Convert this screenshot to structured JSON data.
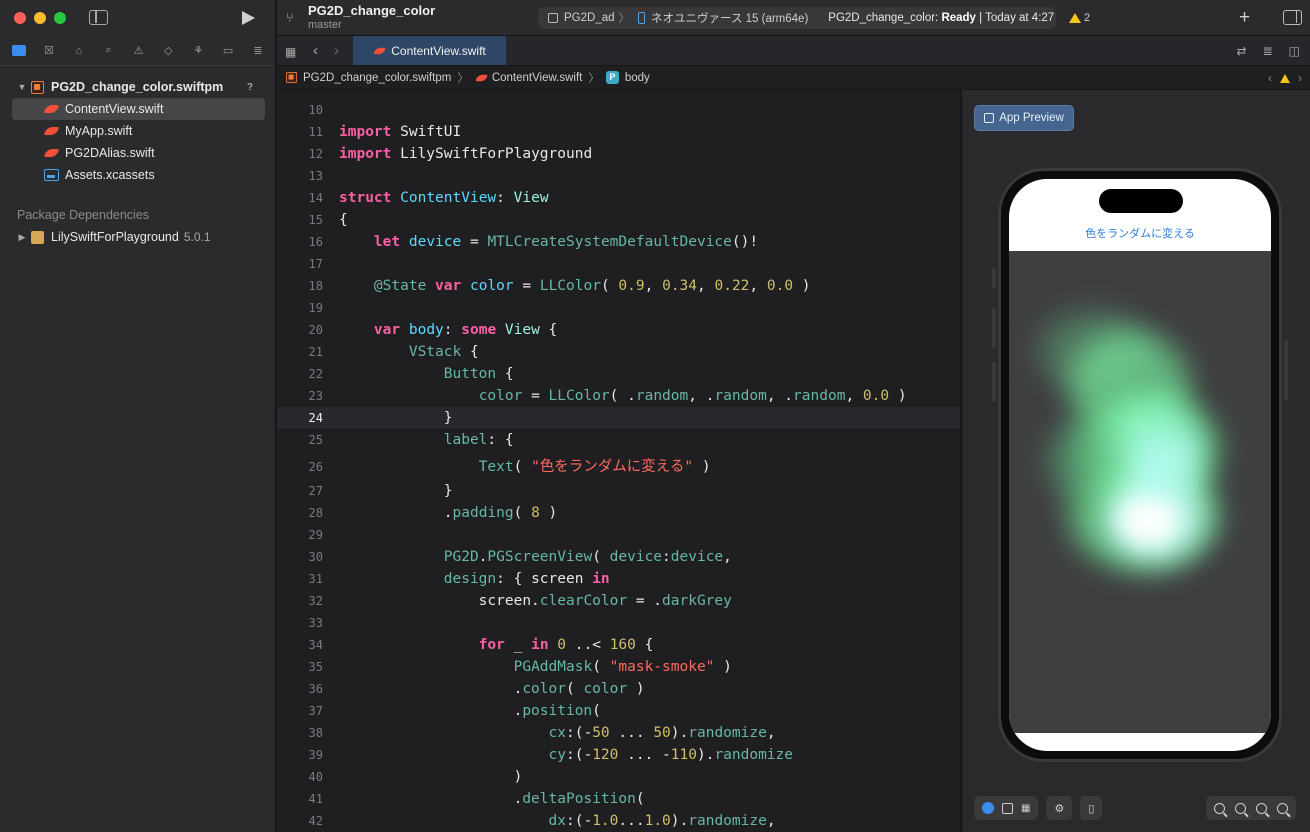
{
  "sidebar": {
    "items": [
      {
        "label": "PG2D_change_color.swiftpm",
        "badge": "?"
      },
      {
        "label": "ContentView.swift"
      },
      {
        "label": "MyApp.swift"
      },
      {
        "label": "PG2DAlias.swift"
      },
      {
        "label": "Assets.xcassets"
      }
    ],
    "dependencies_header": "Package Dependencies",
    "dependency": {
      "name": "LilySwiftForPlayground",
      "version": "5.0.1"
    }
  },
  "toolbar": {
    "project": "PG2D_change_color",
    "branch": "master",
    "scheme_target": "PG2D_ad",
    "device": "ネオユニヴァース 15 (arm64e)",
    "status_prefix": "PG2D_change_color: ",
    "status_state": "Ready",
    "status_time": " | Today at 4:27",
    "warnings": "2"
  },
  "tabbar": {
    "active_tab": "ContentView.swift"
  },
  "jumpbar": {
    "package": "PG2D_change_color.swiftpm",
    "file": "ContentView.swift",
    "symbol_badge": "P",
    "symbol": "body"
  },
  "editor": {
    "current_line": 24
  },
  "preview": {
    "button_label": "App Preview",
    "app_button_text": "色をランダムに変える",
    "accent_color": "#2a7de1",
    "canvas_color": "#3f3f41"
  }
}
